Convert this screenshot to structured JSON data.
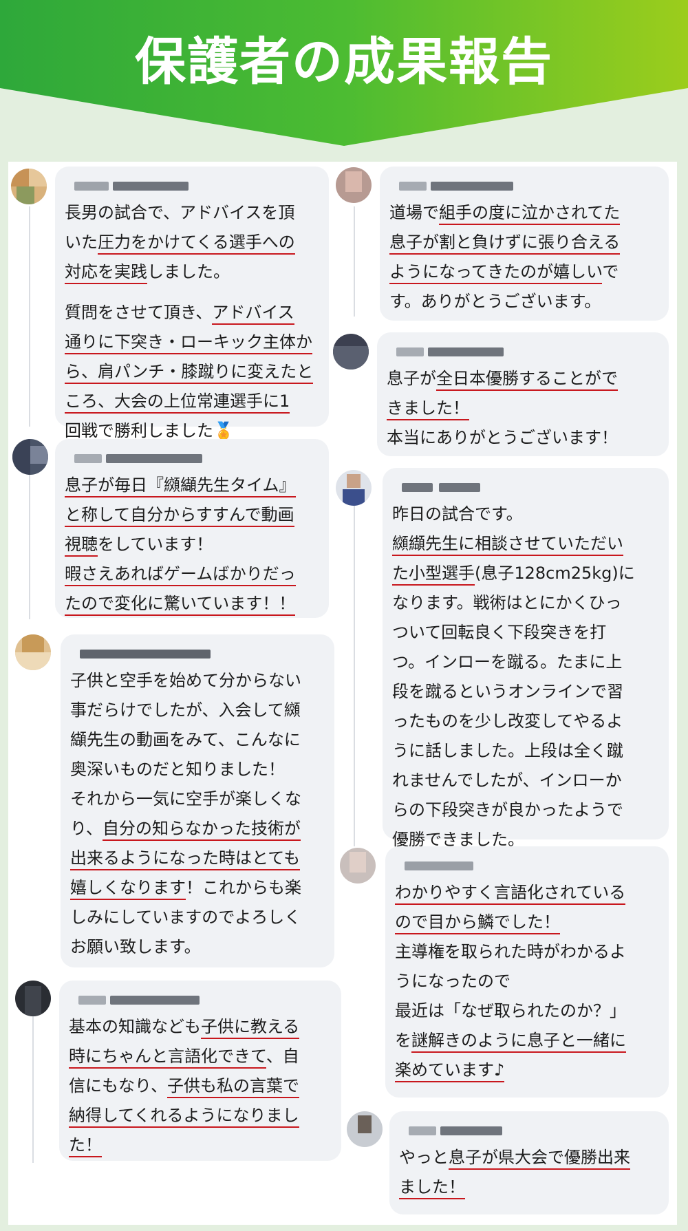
{
  "header": {
    "title": "保護者の成果報告"
  },
  "colors": {
    "green_start": "#2ea83a",
    "green_end": "#9ccd1c",
    "underline": "#c8171d",
    "bubble": "#f0f2f5"
  },
  "comments": [
    {
      "lines": [
        "長男の試合で、アドバイスを頂",
        "いた圧力をかけてくる選手への",
        "対応を実践しました。",
        "質問をさせて頂き、アドバイス",
        "通りに下突き・ローキック主体か",
        "ら、肩パンチ・膝蹴りに変えたと",
        "ころ、大会の上位常連選手に1",
        "回戦で勝利しました"
      ],
      "medal": "🏅"
    },
    {
      "lines": [
        "道場で組手の度に泣かされてた",
        "息子が割と負けずに張り合える",
        "ようになってきたのが嬉しいで",
        "す。ありがとうございます。"
      ]
    },
    {
      "lines": [
        "息子が全日本優勝することがで",
        "きました！",
        "本当にありがとうございます！"
      ]
    },
    {
      "lines": [
        "息子が毎日『纐纈先生タイム』",
        "と称して自分からすすんで動画",
        "視聴をしています！",
        "暇さえあればゲームばかりだっ",
        "たので変化に驚いています！！"
      ]
    },
    {
      "lines": [
        "昨日の試合です。",
        "纐纈先生に相談させていただい",
        "た小型選手(息子128cm25kg)に",
        "なります。戦術はとにかくひっ",
        "ついて回転良く下段突きを打",
        "つ。インローを蹴る。たまに上",
        "段を蹴るというオンラインで習",
        "ったものを少し改変してやるよ",
        "うに話しました。上段は全く蹴",
        "れませんでしたが、インローか",
        "らの下段突きが良かったようで",
        "優勝できました。"
      ]
    },
    {
      "lines": [
        "子供と空手を始めて分からない",
        "事だらけでしたが、入会して纐",
        "纈先生の動画をみて、こんなに",
        "奥深いものだと知りました！",
        "それから一気に空手が楽しくな",
        "り、自分の知らなかった技術が",
        "出来るようになった時はとても",
        "嬉しくなります！これからも楽",
        "しみにしていますのでよろしく",
        "お願い致します。"
      ]
    },
    {
      "lines": [
        "わかりやすく言語化されている",
        "ので目から鱗でした！",
        "主導権を取られた時がわかるよ",
        "うになったので",
        "最近は「なぜ取られたのか？」",
        "を謎解きのように息子と一緒に",
        "楽めています♪"
      ]
    },
    {
      "lines": [
        "基本の知識なども子供に教える",
        "時にちゃんと言語化できて、自",
        "信にもなり、子供も私の言葉で",
        "納得してくれるようになりまし",
        "た！"
      ]
    },
    {
      "lines": [
        "やっと息子が県大会で優勝出来",
        "ました！"
      ]
    }
  ]
}
